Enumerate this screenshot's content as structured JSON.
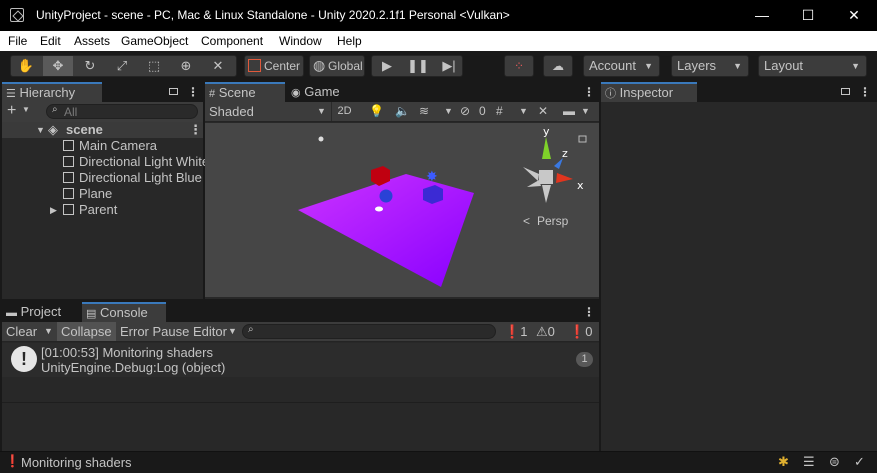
{
  "window": {
    "title": "UnityProject - scene - PC, Mac & Linux Standalone - Unity 2020.2.1f1 Personal <Vulkan>",
    "minimize": "—",
    "maximize": "☐",
    "close": "✕"
  },
  "menu": [
    "File",
    "Edit",
    "Assets",
    "GameObject",
    "Component",
    "Window",
    "Help"
  ],
  "toolbar": {
    "pivot_label": "Center",
    "space_label": "Global",
    "account_label": "Account",
    "layers_label": "Layers",
    "layout_label": "Layout"
  },
  "hierarchy": {
    "tab_label": "Hierarchy",
    "search_placeholder": "All",
    "scene_name": "scene",
    "items": [
      "Main Camera",
      "Directional Light White",
      "Directional Light Blue",
      "Plane",
      "Parent"
    ]
  },
  "scene": {
    "tabs": [
      "Scene",
      "Game"
    ],
    "shading_mode": "Shaded",
    "mode_2d": "2D",
    "hidden_count": "0",
    "gizmo_axes": {
      "x": "x",
      "y": "y",
      "z": "z"
    },
    "projection_label": "Persp"
  },
  "inspector": {
    "tab_label": "Inspector"
  },
  "console": {
    "tabs": [
      "Project",
      "Console"
    ],
    "clear_label": "Clear",
    "collapse_label": "Collapse",
    "error_pause_label": "Error Pause",
    "editor_label": "Editor",
    "log_count": "1",
    "warning_count": "0",
    "error_count": "0",
    "entries": [
      {
        "line1": "[01:00:53] Monitoring shaders",
        "line2": "UnityEngine.Debug:Log (object)",
        "count": "1"
      }
    ]
  },
  "status": {
    "message": "Monitoring shaders"
  },
  "colors": {
    "accent": "#3a79bb",
    "plane_from": "#cc33ff",
    "plane_to": "#8800ff"
  }
}
